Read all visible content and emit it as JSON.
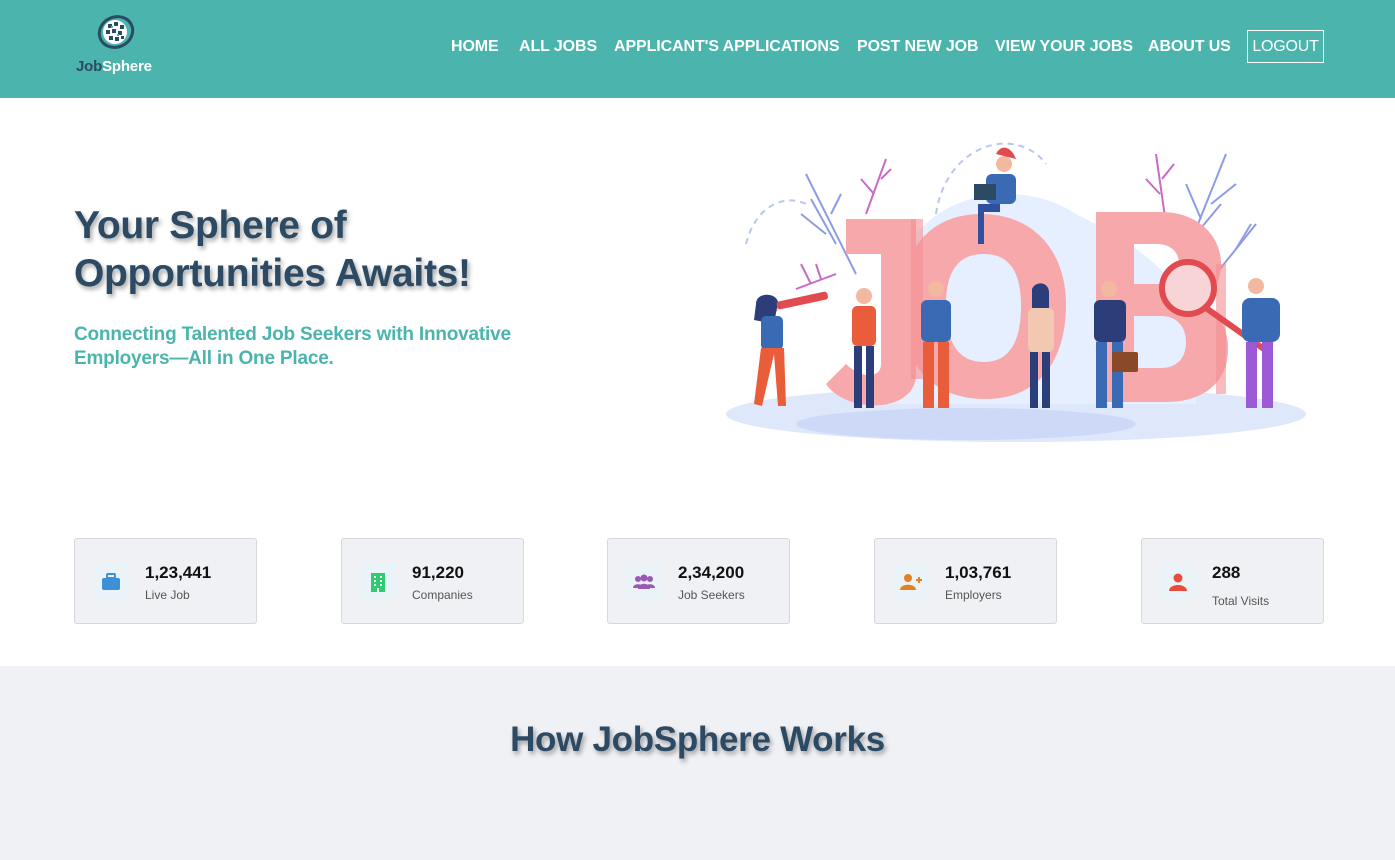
{
  "brand": {
    "name_part1": "Job",
    "name_part2": "Sphere"
  },
  "nav": {
    "items": [
      "HOME",
      "ALL JOBS",
      "APPLICANT'S APPLICATIONS",
      "POST NEW JOB",
      "VIEW YOUR JOBS",
      "ABOUT US"
    ],
    "logout_label": "LOGOUT"
  },
  "hero": {
    "title_line1": "Your Sphere of",
    "title_line2": "Opportunities Awaits!",
    "subtitle": "Connecting Talented Job Seekers with Innovative Employers—All in One Place.",
    "illustration_icon": "job-search-illustration",
    "illustration_text": "JOB"
  },
  "stats": [
    {
      "value": "1,23,441",
      "label": "Live Job",
      "icon": "briefcase-icon",
      "color": "#3d8fd6"
    },
    {
      "value": "91,220",
      "label": "Companies",
      "icon": "building-icon",
      "color": "#2ecc71"
    },
    {
      "value": "2,34,200",
      "label": "Job Seekers",
      "icon": "users-icon",
      "color": "#9b59b6"
    },
    {
      "value": "1,03,761",
      "label": "Employers",
      "icon": "user-plus-icon",
      "color": "#e67e22"
    },
    {
      "value": "288",
      "label": "Total Visits",
      "icon": "user-icon",
      "color": "#e74c3c"
    }
  ],
  "how_it_works": {
    "title": "How JobSphere Works"
  },
  "colors": {
    "primary": "#4ab4ad",
    "heading": "#2c4a63",
    "panel": "#f0f1f5"
  }
}
